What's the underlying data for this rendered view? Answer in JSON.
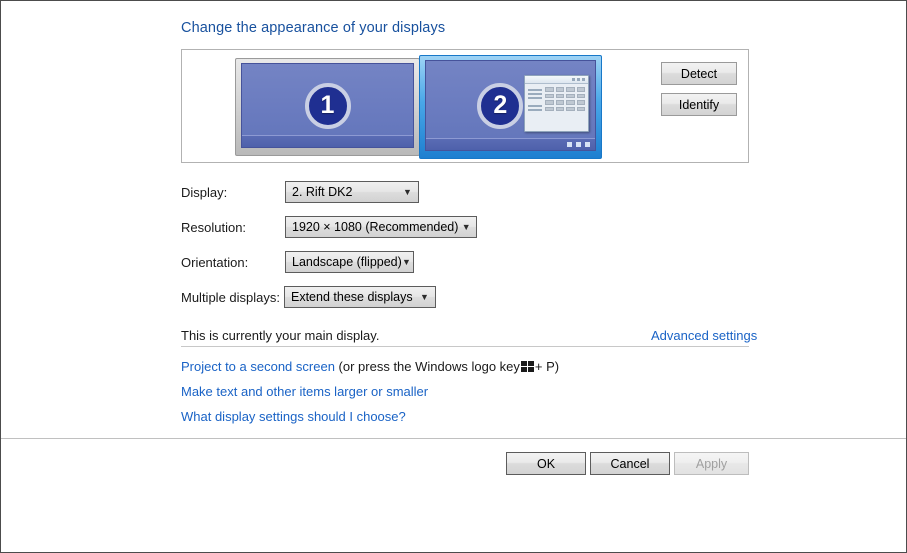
{
  "window": {
    "title": "Change the appearance of your displays"
  },
  "preview": {
    "monitors": [
      {
        "number": "1",
        "selected": false
      },
      {
        "number": "2",
        "selected": true
      }
    ],
    "detect_label": "Detect",
    "identify_label": "Identify"
  },
  "form": {
    "display": {
      "label": "Display:",
      "value": "2. Rift DK2"
    },
    "resolution": {
      "label": "Resolution:",
      "value": "1920 × 1080 (Recommended)"
    },
    "orientation": {
      "label": "Orientation:",
      "value": "Landscape (flipped)"
    },
    "multiple_displays": {
      "label": "Multiple displays:",
      "value": "Extend these displays"
    }
  },
  "status": {
    "main_display_text": "This is currently your main display.",
    "advanced_settings_link": "Advanced settings"
  },
  "links": {
    "project_link": "Project to a second screen",
    "project_suffix_before_logo": "(or press the Windows logo key",
    "project_suffix_after_logo": "+ P)",
    "text_size_link": "Make text and other items larger or smaller",
    "what_settings_link": "What display settings should I choose?"
  },
  "footer": {
    "ok_label": "OK",
    "cancel_label": "Cancel",
    "apply_label": "Apply"
  },
  "colors": {
    "title_blue": "#18519e",
    "link_blue": "#1a63c6",
    "selection_blue": "#1e7fd0",
    "screen_blue": "#6b7cc0",
    "badge_navy": "#1f2f91"
  }
}
